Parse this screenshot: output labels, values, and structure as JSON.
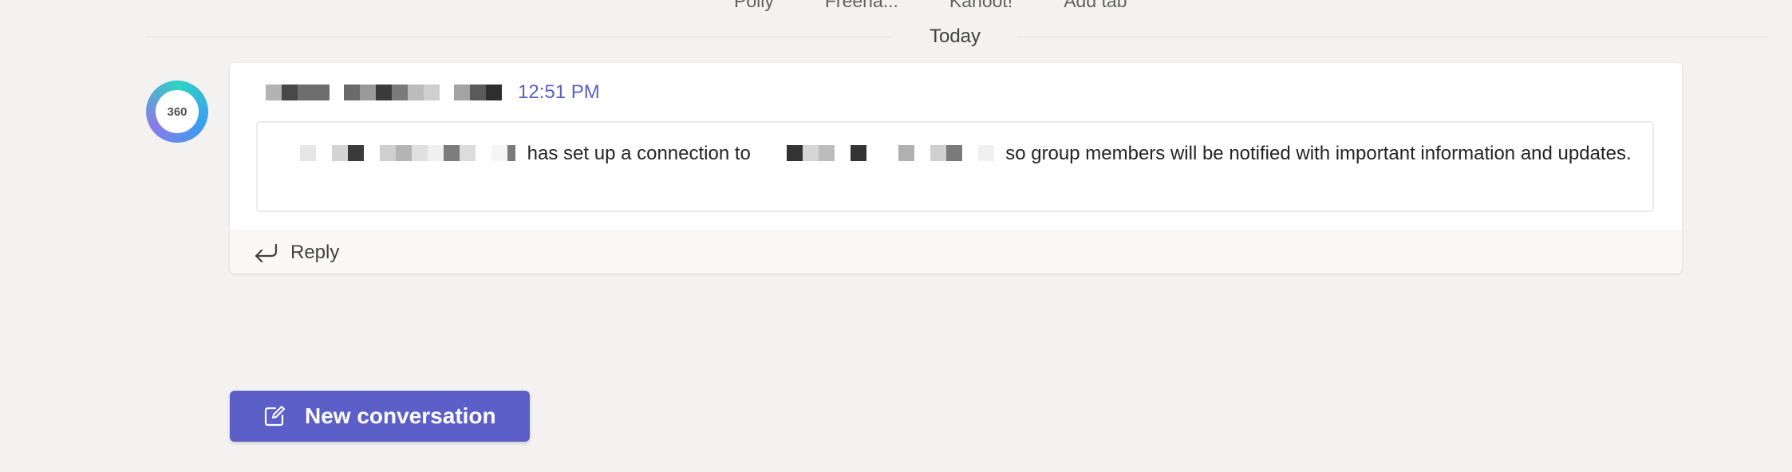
{
  "tabs": [
    "Polly",
    "Freena...",
    "Kahoot!",
    "Add tab"
  ],
  "divider": {
    "label": "Today"
  },
  "avatar": {
    "text": "360"
  },
  "post": {
    "time": "12:51 PM",
    "message_part1": " has set up a connection to ",
    "message_part2": " so group members will be notified with important information and updates."
  },
  "reply": {
    "label": "Reply"
  },
  "new_conversation": {
    "label": "New conversation"
  },
  "colors": {
    "accent": "#5b5fc7",
    "background": "#f3f2f1",
    "card": "#ffffff"
  },
  "icons": {
    "reply": "reply-arrow-icon",
    "new_conversation": "compose-icon"
  }
}
